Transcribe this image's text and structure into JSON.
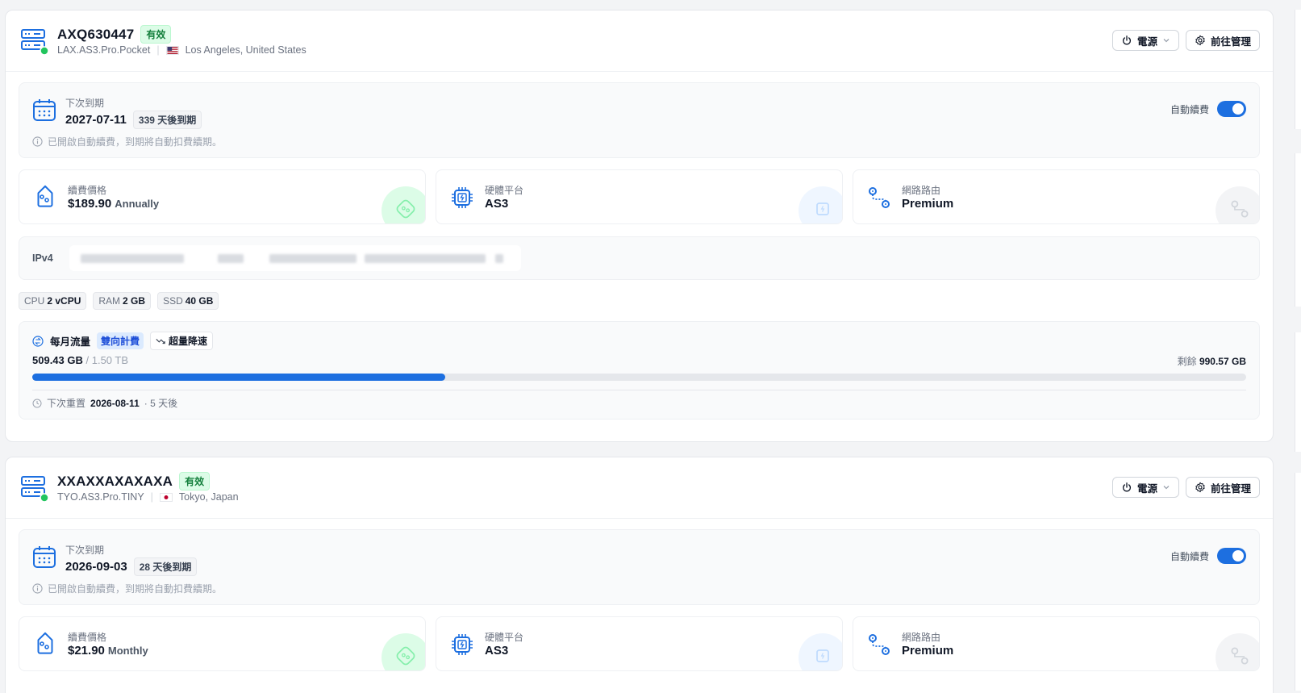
{
  "cards": [
    {
      "server_name": "AXQ630447",
      "status": "有效",
      "plan": "LAX.AS3.Pro.Pocket",
      "location": "Los Angeles, United States",
      "power_label": "電源",
      "manage_label": "前往管理",
      "expiry_label": "下次到期",
      "expiry_date": "2027-07-11",
      "days_left": "339 天後到期",
      "auto_renew_note": "已開啟自動續費，到期將自動扣費續期。",
      "auto_renew_label": "自動續費",
      "auto_renew_on": true,
      "price_label": "續費價格",
      "price": "$189.90",
      "period": "Annually",
      "platform_label": "硬體平台",
      "platform": "AS3",
      "route_label": "網路路由",
      "route": "Premium",
      "ipv4_label": "IPv4",
      "specs": [
        {
          "name": "CPU",
          "value": "2 vCPU"
        },
        {
          "name": "RAM",
          "value": "2 GB"
        },
        {
          "name": "SSD",
          "value": "40 GB"
        }
      ],
      "traffic_label": "每月流量",
      "billing_mode": "雙向計費",
      "overage": "超量降速",
      "used": "509.43 GB",
      "total": "/ 1.50 TB",
      "remaining_label": "剩餘",
      "remaining": "990.57 GB",
      "usage_fraction": 0.34,
      "reset_label": "下次重置",
      "reset_date": "2026-08-11",
      "reset_in": "· 5 天後"
    },
    {
      "server_name": "XXAXXAXAXAXA",
      "status": "有效",
      "plan": "TYO.AS3.Pro.TINY",
      "location": "Tokyo, Japan",
      "power_label": "電源",
      "manage_label": "前往管理",
      "expiry_label": "下次到期",
      "expiry_date": "2026-09-03",
      "days_left": "28 天後到期",
      "auto_renew_note": "已開啟自動續費，到期將自動扣費續期。",
      "auto_renew_label": "自動續費",
      "auto_renew_on": true,
      "price_label": "續費價格",
      "price": "$21.90",
      "period": "Monthly",
      "platform_label": "硬體平台",
      "platform": "AS3",
      "route_label": "網路路由",
      "route": "Premium"
    }
  ],
  "colors": {
    "accent": "#1d6fe0",
    "status_online": "#22c55e",
    "badge_bg": "#dcfce7",
    "badge_text": "#15803d"
  },
  "icons": [
    "server-icon",
    "power-icon",
    "chevron-down-icon",
    "gear-icon",
    "calendar-icon",
    "info-icon",
    "price-tag-icon",
    "cpu-chip-icon",
    "route-icon",
    "traffic-icon",
    "trend-down-icon",
    "clock-icon"
  ]
}
